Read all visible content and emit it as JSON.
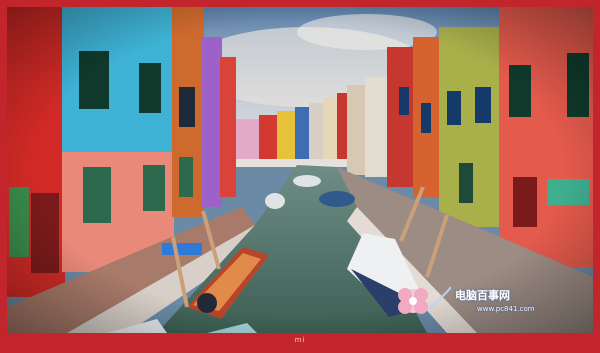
{
  "photo": {
    "subject": "burano-canal-street-with-colorful-houses-and-boats"
  },
  "bezel": {
    "brand_label": "mi",
    "color": "#c2262c"
  },
  "watermark": {
    "site_name": "电脑百事网",
    "url": "www.pc841.com",
    "icon": "flower-logo-icon"
  }
}
